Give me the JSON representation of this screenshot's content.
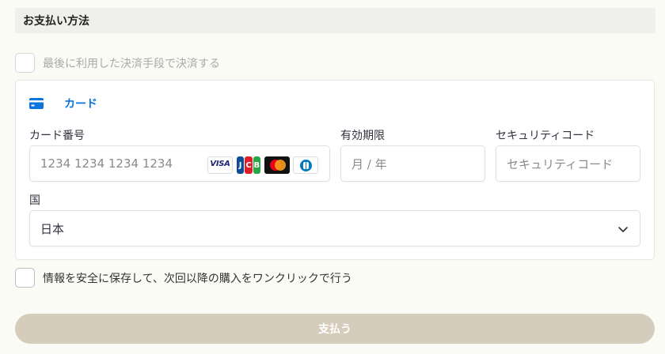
{
  "section": {
    "title": "お支払い方法"
  },
  "reuse_method": {
    "label": "最後に利用した決済手段で決済する",
    "checked": false
  },
  "tab": {
    "label": "カード",
    "icon": "credit-card-icon",
    "color": "#0b74de"
  },
  "card_number": {
    "label": "カード番号",
    "placeholder": "1234 1234 1234 1234"
  },
  "brands": {
    "visa": "VISA",
    "jcb": [
      "J",
      "C",
      "B"
    ]
  },
  "expiry": {
    "label": "有効期限",
    "placeholder": "月 / 年"
  },
  "cvc": {
    "label": "セキュリティコード",
    "placeholder": "セキュリティコード"
  },
  "country": {
    "label": "国",
    "value": "日本",
    "icon": "chevron-down-icon"
  },
  "save_info": {
    "label": "情報を安全に保存して、次回以降の購入をワンクリックで行う",
    "checked": false
  },
  "pay_button": {
    "label": "支払う",
    "color": "#d5ccbb"
  }
}
